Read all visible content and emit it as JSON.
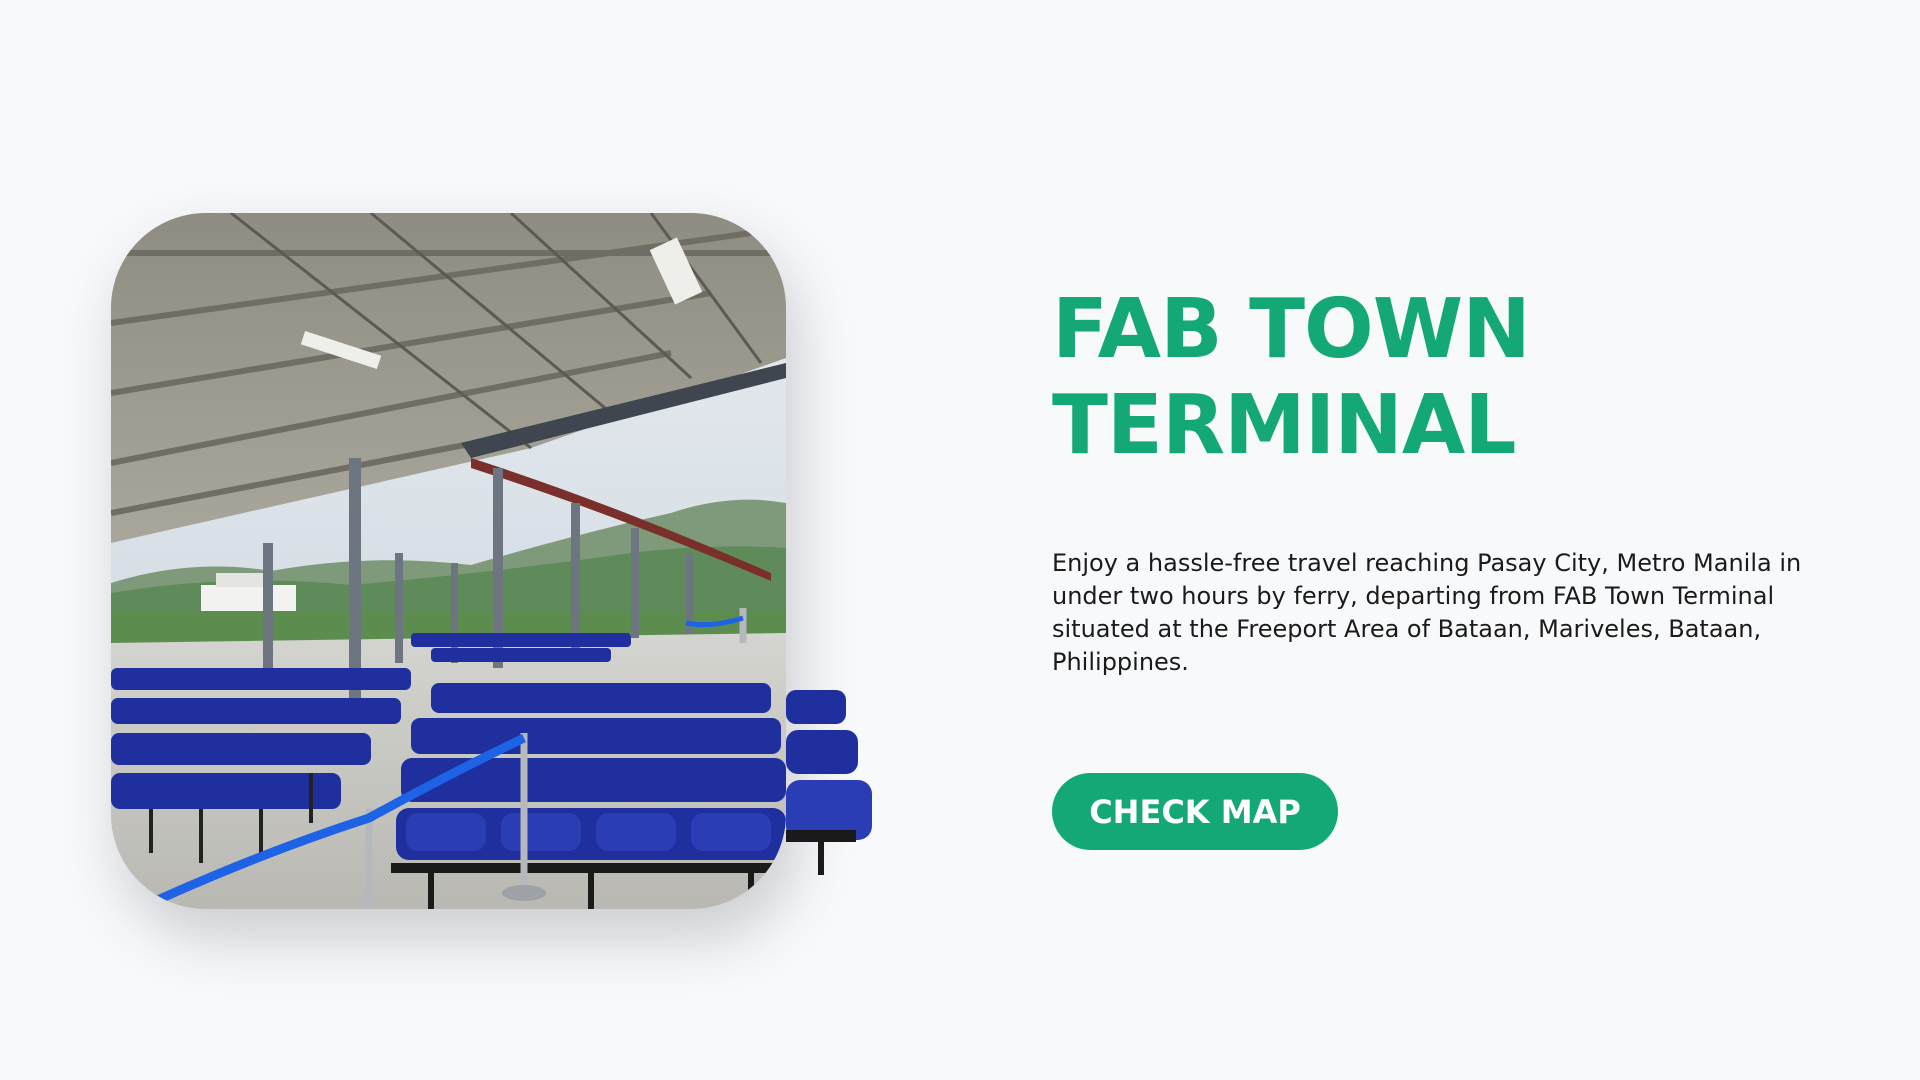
{
  "hero": {
    "title_line1": "FAB TOWN",
    "title_line2": "TERMINAL",
    "description": "Enjoy a hassle-free travel reaching Pasay City, Metro Manila in under two hours by ferry, departing from FAB Town Terminal situated at the Freeport Area of Bataan, Mariveles, Bataan, Philippines.",
    "button_label": "CHECK MAP"
  },
  "colors": {
    "accent": "#13a876",
    "background": "#f8f9fb",
    "text": "#1b1b1b",
    "seat_blue": "#1f2f9e",
    "rope_blue": "#1e63e6"
  }
}
